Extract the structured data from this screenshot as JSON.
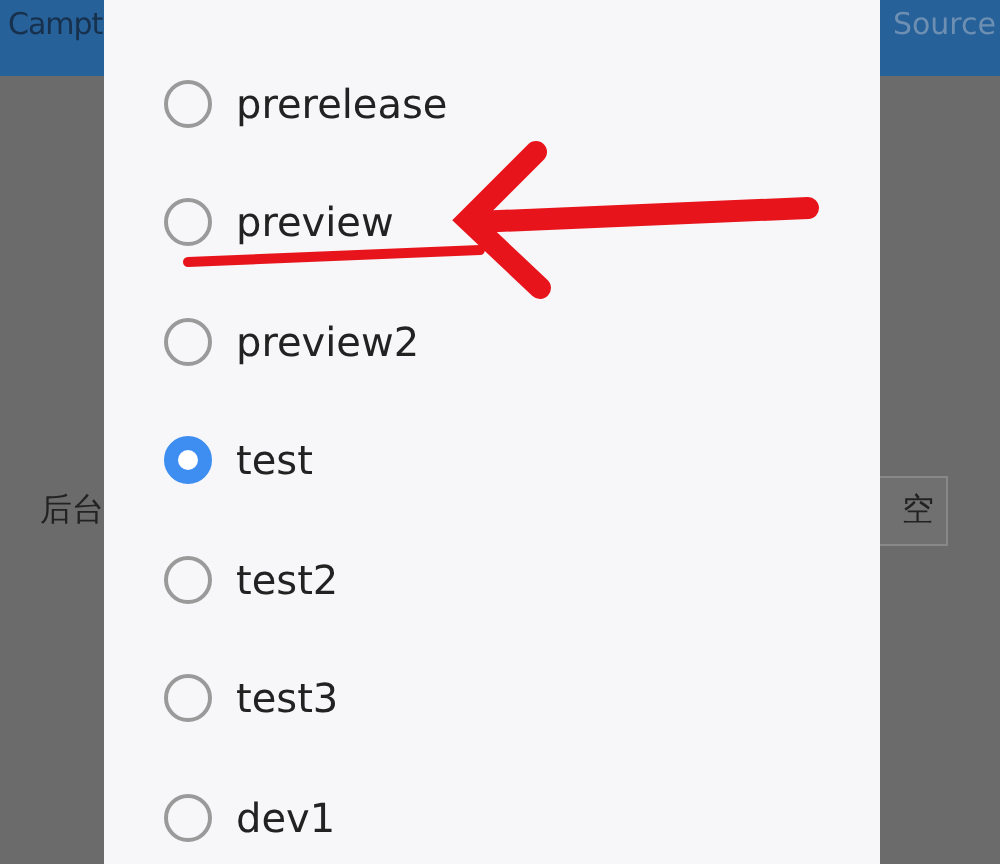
{
  "background": {
    "top_bar": {
      "left_title": "Campt",
      "right_title": "Source"
    },
    "row_label": "后台",
    "clear_button": "空"
  },
  "dialog": {
    "options": [
      {
        "label": "prerelease",
        "selected": false
      },
      {
        "label": "preview",
        "selected": false
      },
      {
        "label": "preview2",
        "selected": false
      },
      {
        "label": "test",
        "selected": true
      },
      {
        "label": "test2",
        "selected": false
      },
      {
        "label": "test3",
        "selected": false
      },
      {
        "label": "dev1",
        "selected": false
      }
    ]
  }
}
